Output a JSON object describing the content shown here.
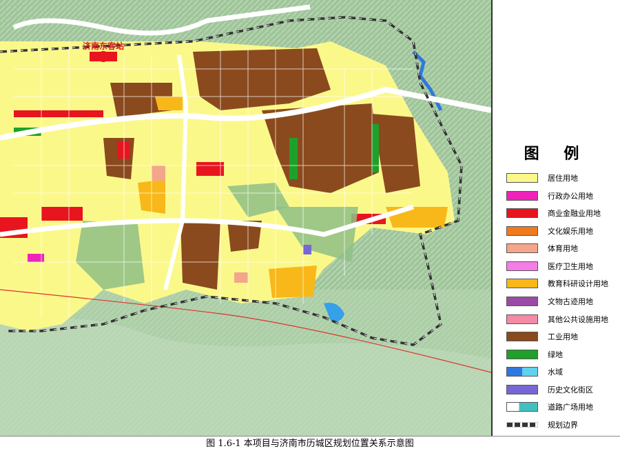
{
  "map": {
    "station_label": "济南东客站"
  },
  "legend": {
    "title": "图 例",
    "items": [
      {
        "label": "居住用地",
        "color": "#fbf88a"
      },
      {
        "label": "行政办公用地",
        "color": "#ee22bb"
      },
      {
        "label": "商业金融业用地",
        "color": "#e8141e"
      },
      {
        "label": "文化娱乐用地",
        "color": "#f07a1e"
      },
      {
        "label": "体育用地",
        "color": "#f4a68a"
      },
      {
        "label": "医疗卫生用地",
        "color": "#f27ee6"
      },
      {
        "label": "教育科研设计用地",
        "color": "#f8b81a"
      },
      {
        "label": "文物古迹用地",
        "color": "#9c4aa8"
      },
      {
        "label": "其他公共设施用地",
        "color": "#f58aa6"
      },
      {
        "label": "工业用地",
        "color": "#8a4a1e"
      },
      {
        "label": "绿地",
        "color": "#1fa02a"
      },
      {
        "label": "水域",
        "color": "#36a0e8"
      },
      {
        "label": "历史文化街区",
        "color": "#7766d6"
      },
      {
        "label": "道路广场用地",
        "color": "#42c0c0"
      },
      {
        "label": "规划边界",
        "color": "#333333"
      }
    ]
  },
  "caption": "图 1.6-1  本项目与济南市历城区规划位置关系示意图"
}
